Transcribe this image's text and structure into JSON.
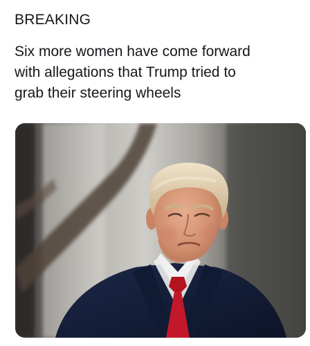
{
  "post": {
    "label": "BREAKING",
    "lines": [
      "Six more women have come forward",
      "with allegations that Trump tried to",
      "grab their steering wheels"
    ]
  },
  "photo": {
    "subject": "portrait-photo",
    "colors": {
      "suit": "#16213d",
      "tie": "#c2182a",
      "shirt": "#f1f1f1",
      "hair": "#d9c7a4",
      "skin": "#d99a7b"
    }
  }
}
